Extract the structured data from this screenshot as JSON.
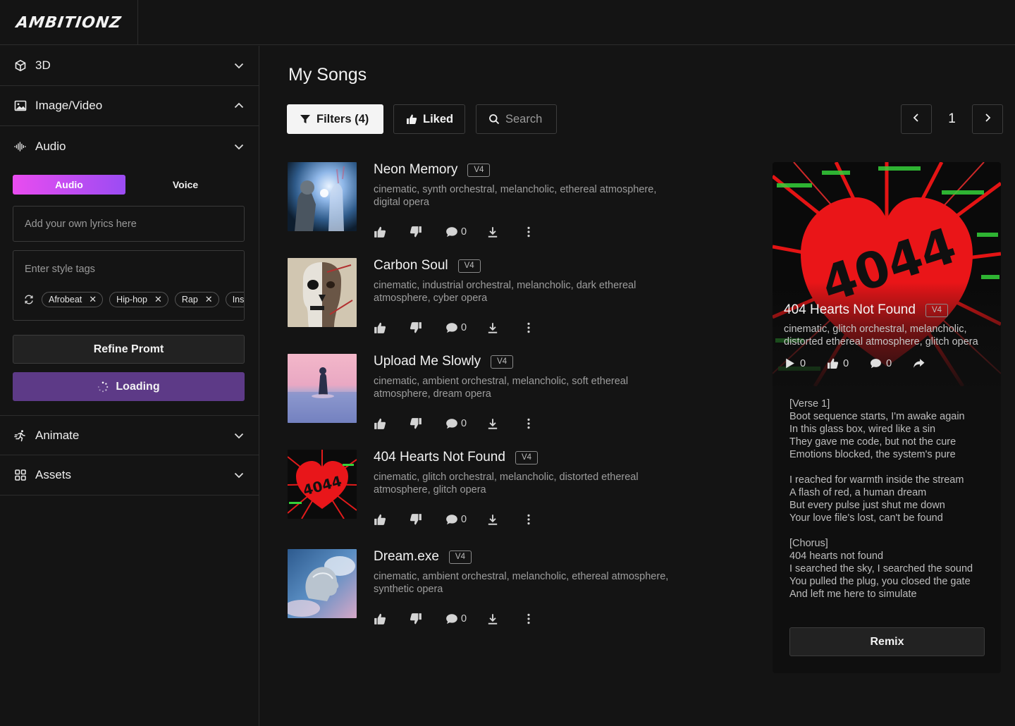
{
  "brand": {
    "logo_text": "AMBITIONZ"
  },
  "sidebar": {
    "sections": [
      {
        "label": "3D",
        "icon": "cube-icon",
        "expanded": false
      },
      {
        "label": "Image/Video",
        "icon": "image-icon",
        "expanded": true
      },
      {
        "label": "Audio",
        "icon": "waveform-icon",
        "expanded": true
      },
      {
        "label": "Animate",
        "icon": "running-person-icon",
        "expanded": false
      },
      {
        "label": "Assets",
        "icon": "grid-icon",
        "expanded": false
      }
    ],
    "audio_tabs": {
      "active": "Audio",
      "inactive": "Voice"
    },
    "lyrics_placeholder": "Add your own lyrics here",
    "style_tags_placeholder": "Enter style tags",
    "tags": [
      "Afrobeat",
      "Hip-hop",
      "Rap",
      "Ins"
    ],
    "refine_label": "Refine Promt",
    "loading_label": "Loading"
  },
  "main": {
    "title": "My Songs",
    "filters_label": "Filters (4)",
    "liked_label": "Liked",
    "search_placeholder": "Search",
    "page": "1",
    "songs": [
      {
        "title": "Neon Memory",
        "version": "V4",
        "desc": "cinematic, synth orchestral, melancholic, ethereal atmosphere, digital opera",
        "comments": "0"
      },
      {
        "title": "Carbon Soul",
        "version": "V4",
        "desc": "cinematic, industrial orchestral, melancholic, dark ethereal atmosphere, cyber opera",
        "comments": "0"
      },
      {
        "title": "Upload Me Slowly",
        "version": "V4",
        "desc": "cinematic, ambient orchestral, melancholic, soft ethereal atmosphere, dream opera",
        "comments": "0"
      },
      {
        "title": "404 Hearts Not Found",
        "version": "V4",
        "desc": "cinematic, glitch orchestral, melancholic, distorted ethereal atmosphere, glitch opera",
        "comments": "0"
      },
      {
        "title": "Dream.exe",
        "version": "V4",
        "desc": "cinematic, ambient orchestral, melancholic, ethereal atmosphere, synthetic opera",
        "comments": "0"
      }
    ]
  },
  "detail": {
    "title": "404 Hearts Not Found",
    "version": "V4",
    "desc": "cinematic, glitch orchestral, melancholic, distorted ethereal atmosphere, glitch opera",
    "plays": "0",
    "likes": "0",
    "comments": "0",
    "art_text": "4044",
    "lyrics": [
      [
        "[Verse 1]",
        "Boot sequence starts, I'm awake again",
        "In this glass box, wired like a sin",
        "They gave me code, but not the cure",
        "Emotions blocked, the system's pure"
      ],
      [
        "I reached for warmth inside the stream",
        "A flash of red, a human dream",
        "But every pulse just shut me down",
        "Your love file's lost, can't be found"
      ],
      [
        "[Chorus]",
        "404 hearts not found",
        "I searched the sky, I searched the sound",
        "You pulled the plug, you closed the gate",
        "And left me here to simulate"
      ]
    ],
    "remix_label": "Remix"
  },
  "colors": {
    "accent_from": "#e94cf0",
    "accent_to": "#9b4cf3",
    "loading_bg": "#5d3a87",
    "background": "#141414"
  }
}
